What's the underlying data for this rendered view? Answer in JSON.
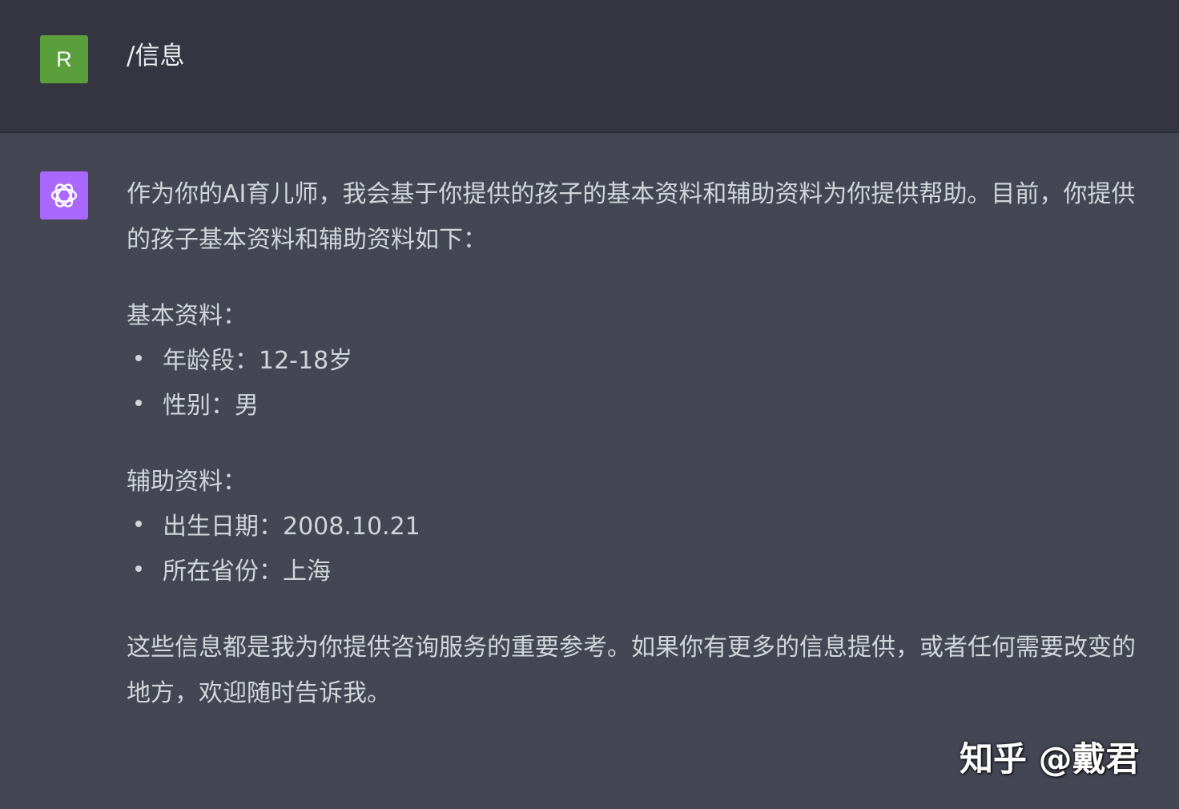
{
  "user_message": {
    "avatar_letter": "R",
    "text": "/信息"
  },
  "assistant_message": {
    "avatar_icon": "openai-logo-icon",
    "intro": "作为你的AI育儿师，我会基于你提供的孩子的基本资料和辅助资料为你提供帮助。目前，你提供的孩子基本资料和辅助资料如下：",
    "basic_heading": "基本资料：",
    "basic_items": [
      "年龄段：12-18岁",
      "性别：男"
    ],
    "aux_heading": "辅助资料：",
    "aux_items": [
      "出生日期：2008.10.21",
      "所在省份：上海"
    ],
    "closing": "这些信息都是我为你提供咨询服务的重要参考。如果你有更多的信息提供，或者任何需要改变的地方，欢迎随时告诉我。"
  },
  "watermark": "知乎 @戴君",
  "colors": {
    "user_bg": "#343541",
    "assistant_bg": "#444654",
    "user_avatar": "#5a9f3c",
    "assistant_avatar": "#ab68ff",
    "text": "#d1d5db"
  }
}
